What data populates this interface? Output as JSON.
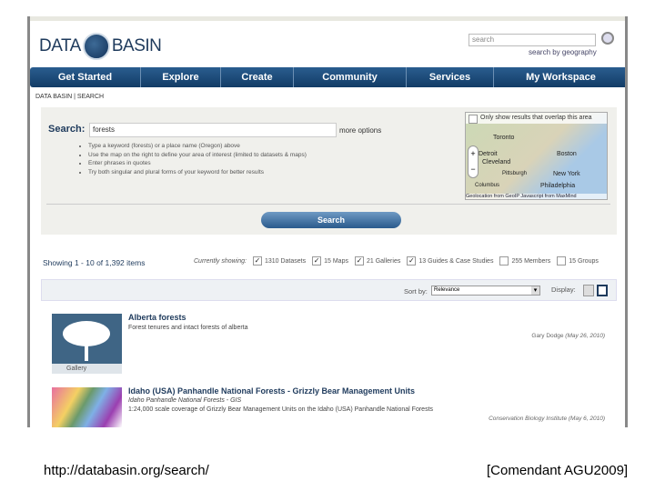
{
  "header": {
    "logo_left": "DATA",
    "logo_right": "BASIN",
    "search_placeholder": "search",
    "geo_link": "search by geography"
  },
  "nav": [
    "Get Started",
    "Explore",
    "Create",
    "Community",
    "Services",
    "My Workspace"
  ],
  "breadcrumb": "DATA BASIN | SEARCH",
  "search": {
    "label": "Search:",
    "value": "forests",
    "more_options": "more options",
    "tips": [
      "Type a keyword (forests) or a place name (Oregon) above",
      "Use the map on the right to define your area of interest (limited to datasets & maps)",
      "Enter phrases in quotes",
      "Try both singular and plural forms of your keyword for better results"
    ],
    "button": "Search"
  },
  "map": {
    "overlap_label": "Only show results that overlap this area",
    "cities": [
      "Toronto",
      "Detroit",
      "Cleveland",
      "Boston",
      "New York",
      "Pittsburgh",
      "Columbus",
      "Philadelphia"
    ],
    "attribution": "Geolocation from GeoIP Javascript from MaxMind"
  },
  "results_header": {
    "showing": "Showing 1 - 10 of 1,392 items",
    "currently_showing": "Currently showing:",
    "filters": [
      {
        "label": "1310 Datasets",
        "checked": true
      },
      {
        "label": "15 Maps",
        "checked": true
      },
      {
        "label": "21 Galleries",
        "checked": true
      },
      {
        "label": "13 Guides & Case Studies",
        "checked": true
      },
      {
        "label": "255 Members",
        "checked": false
      },
      {
        "label": "15 Groups",
        "checked": false
      }
    ]
  },
  "sort": {
    "label": "Sort by:",
    "value": "Relevance",
    "display_label": "Display:"
  },
  "results": [
    {
      "title": "Alberta forests",
      "subtitle": "Forest tenures and intact forests of alberta",
      "author": "Gary Dodge",
      "date": "(May 26, 2010)",
      "badge": "Gallery"
    },
    {
      "title": "Idaho (USA) Panhandle National Forests - Grizzly Bear Management Units",
      "source": "Idaho Panhandle National Forests - GIS",
      "subtitle": "1:24,000 scale coverage of Grizzly Bear Management Units on the Idaho (USA) Panhandle National Forests",
      "author": "Conservation Biology Institute",
      "date": "(May 6, 2010)"
    }
  ],
  "caption": {
    "url": "http://databasin.org/search/",
    "credit": "[Comendant AGU2009]"
  }
}
